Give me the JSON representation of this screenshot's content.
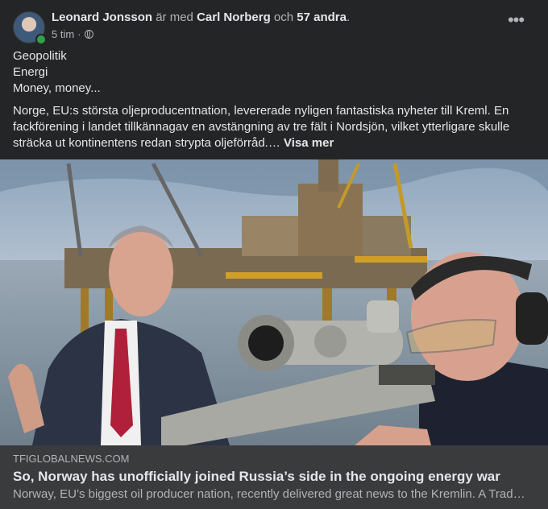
{
  "post": {
    "author": "Leonard Jonsson",
    "with_text": "är med",
    "tagged": "Carl Norberg",
    "and_text": "och",
    "others": "57 andra",
    "period": ".",
    "time": "5 tim",
    "separator": "·",
    "privacy_icon": "globe-icon",
    "more_icon": "more-options-icon",
    "more_symbol": "•••",
    "lines": [
      "Geopolitik",
      "Energi",
      "Money, money..."
    ],
    "paragraph": "Norge, EU:s största oljeproducentnation, levererade nyligen fantastiska nyheter till Kreml. En fackförening i landet tillkännagav en avstängning av tre fält i Nordsjön, vilket ytterligare skulle sträcka ut kontinentens redan strypta oljeförråd.…",
    "see_more": "Visa mer"
  },
  "link_preview": {
    "domain": "TFIGLOBALNEWS.COM",
    "title": "So, Norway has unofficially joined Russia’s side in the ongoing energy war",
    "description": "Norway, EU’s biggest oil producer nation, recently delivered great news to the Kremlin. A Trad…"
  },
  "colors": {
    "card_bg": "#242526",
    "link_bg": "#3a3b3c",
    "primary_text": "#e4e6eb",
    "secondary_text": "#b0b3b8",
    "online_dot": "#31a24c"
  }
}
